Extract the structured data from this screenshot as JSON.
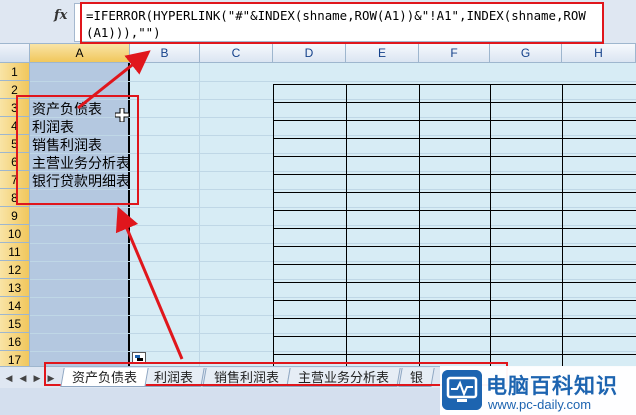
{
  "formula_bar": {
    "fx_label": "fx",
    "formula": "=IFERROR(HYPERLINK(\"#\"&INDEX(shname,ROW(A1))&\"!A1\",INDEX(shname,ROW(A1))),\"\")"
  },
  "columns": [
    "A",
    "B",
    "C",
    "D",
    "E",
    "F",
    "G",
    "H"
  ],
  "rows": [
    "1",
    "2",
    "3",
    "4",
    "5",
    "6",
    "7",
    "8",
    "9",
    "10",
    "11",
    "12",
    "13",
    "14",
    "15",
    "16",
    "17"
  ],
  "cells": {
    "a3": "资产负债表",
    "a4": "利润表",
    "a5": "销售利润表",
    "a6": "主营业务分析表",
    "a7": "银行贷款明细表"
  },
  "sheet_tabs": [
    "资产负债表",
    "利润表",
    "销售利润表",
    "主营业务分析表",
    "银"
  ],
  "active_tab_index": 0,
  "logo": {
    "title": "电脑百科知识",
    "url": "www.pc-daily.com"
  },
  "colors": {
    "annotation_red": "#e0161c",
    "selection_blue": "#b4c8e0",
    "logo_blue": "#1d64b0"
  }
}
